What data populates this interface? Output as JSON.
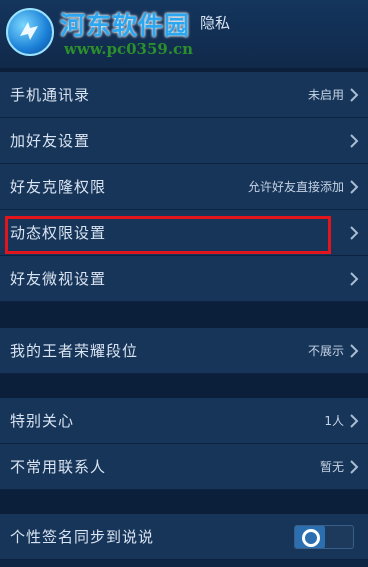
{
  "header": {
    "title": "隐私",
    "watermark_title": "河东软件园",
    "watermark_url": "www.pc0359.cn"
  },
  "settings": {
    "contacts": {
      "label": "手机通讯录",
      "value": "未启用"
    },
    "add_friend": {
      "label": "加好友设置"
    },
    "friend_clone": {
      "label": "好友克隆权限",
      "value": "允许好友直接添加"
    },
    "dynamic_perm": {
      "label": "动态权限设置"
    },
    "friend_view": {
      "label": "好友微视设置"
    },
    "rank": {
      "label": "我的王者荣耀段位",
      "value": "不展示"
    },
    "special_care": {
      "label": "特别关心",
      "value": "1人"
    },
    "uncommon": {
      "label": "不常用联系人",
      "value": "暂无"
    },
    "signature_sync": {
      "label": "个性签名同步到说说",
      "enabled": true
    }
  },
  "colors": {
    "highlight_border": "#e0161c",
    "row_bg": "#173559",
    "page_bg": "#0f2544"
  }
}
